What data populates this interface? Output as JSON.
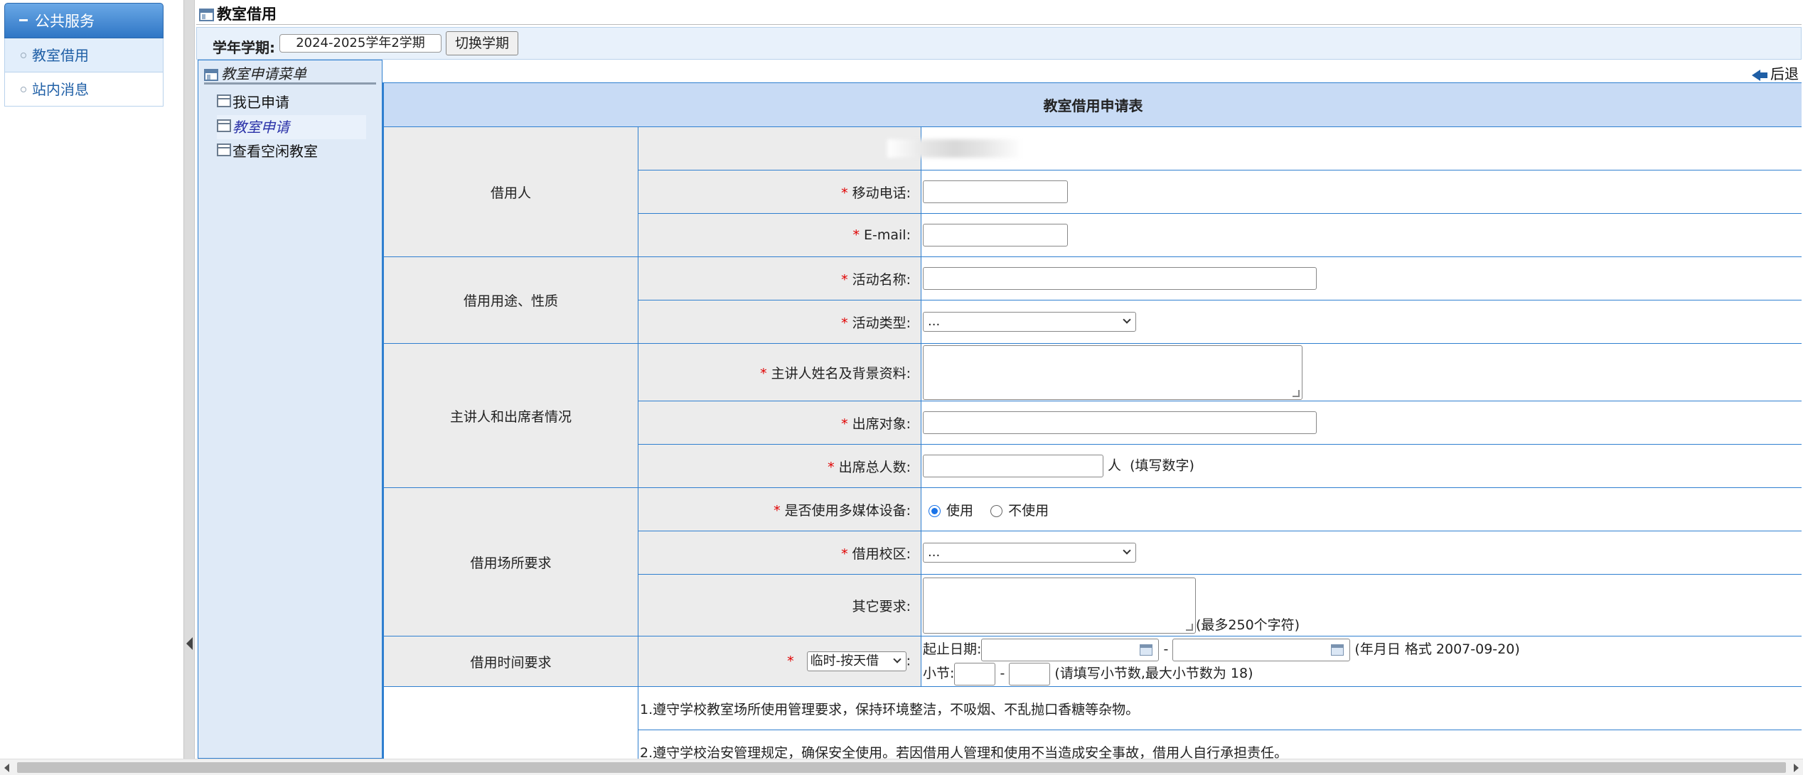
{
  "nav": {
    "header": "公共服务",
    "items": [
      {
        "label": "教室借用",
        "active": true
      },
      {
        "label": "站内消息",
        "active": false
      }
    ]
  },
  "page": {
    "title": "教室借用"
  },
  "term": {
    "label": "学年学期:",
    "selected": "2024-2025学年2学期",
    "switch_button": "切换学期"
  },
  "submenu": {
    "title": "教室申请菜单",
    "items": [
      {
        "label": "我已申请"
      },
      {
        "label": "教室申请"
      },
      {
        "label": "查看空闲教室"
      }
    ]
  },
  "back": {
    "label": "后退"
  },
  "form": {
    "title": "教室借用申请表",
    "groups": {
      "borrower": "借用人",
      "purpose": "借用用途、性质",
      "speaker": "主讲人和出席者情况",
      "venue": "借用场所要求",
      "time": "借用时间要求"
    },
    "required_mark": "*",
    "colon": ":",
    "fields": {
      "mobile": "移动电话:",
      "email": "E-mail:",
      "activity_name": "活动名称:",
      "activity_type": "活动类型:",
      "speaker_info": "主讲人姓名及背景资料:",
      "audience": "出席对象:",
      "attendee_count": "出席总人数:",
      "multimedia": "是否使用多媒体设备:",
      "campus": "借用校区:",
      "other": "其它要求:"
    },
    "activity_type_value": "...",
    "campus_value": "...",
    "attendee_unit": "人  (填写数字)",
    "multimedia_options": {
      "yes": "使用",
      "no": "不使用"
    },
    "other_hint": "(最多250个字符)",
    "time_mode": "临时-按天借",
    "date_label": "起止日期:",
    "date_dash": "-",
    "date_hint": "(年月日 格式 2007-09-20)",
    "period_label": "小节:",
    "period_dash": "-",
    "period_hint": "(请填写小节数,最大小节数为 18)",
    "rules": [
      "1.遵守学校教室场所使用管理要求，保持环境整洁，不吸烟、不乱抛口香糖等杂物。",
      "2.遵守学校治安管理规定，确保安全使用。若因借用人管理和使用不当造成安全事故，借用人自行承担责任。"
    ]
  }
}
